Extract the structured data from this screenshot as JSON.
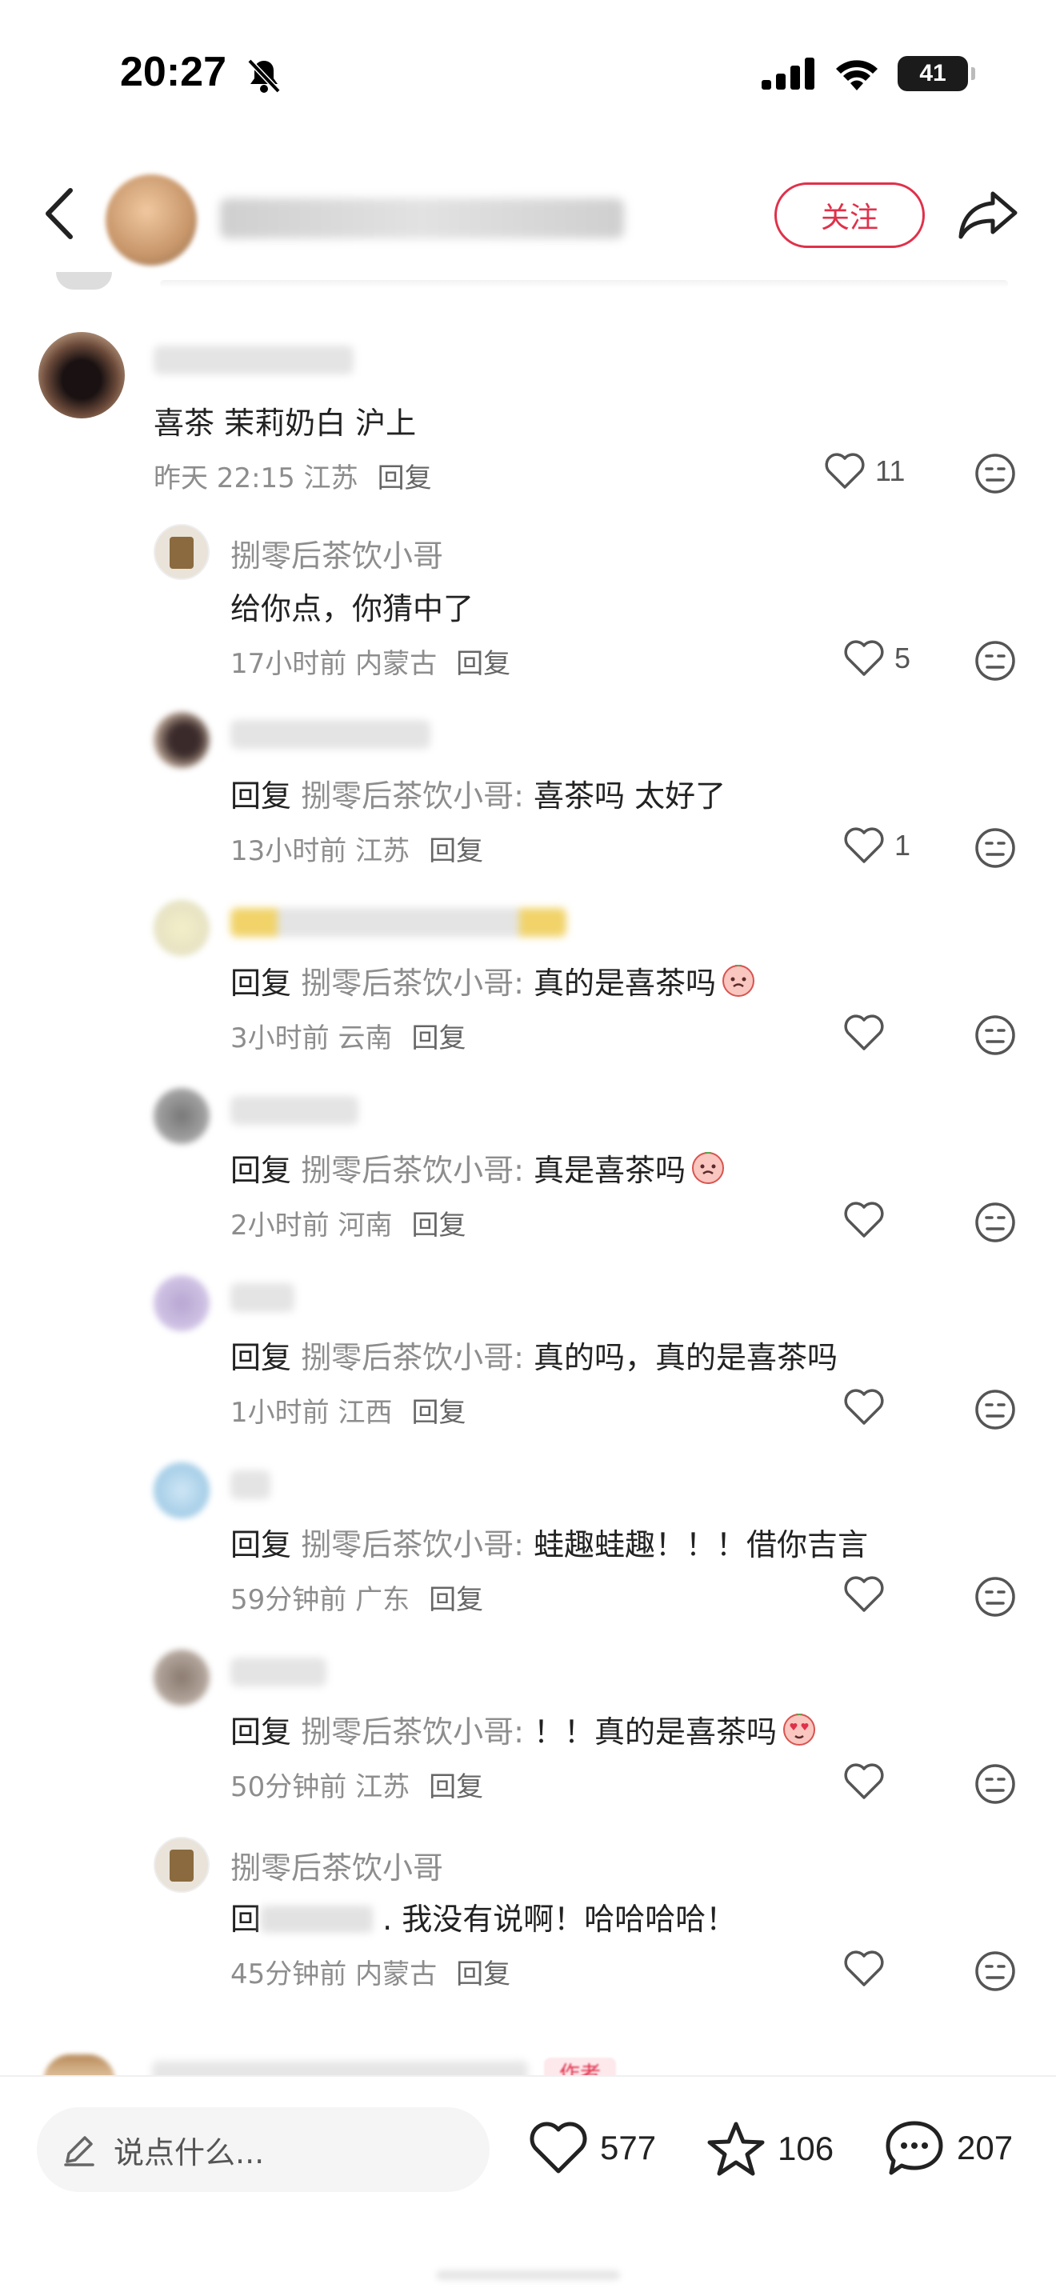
{
  "status_bar": {
    "time": "20:27",
    "battery": "41"
  },
  "header": {
    "follow_label": "关注"
  },
  "comments": [
    {
      "text": "喜茶 茉莉奶白 沪上",
      "time": "昨天 22:15",
      "location": "江苏",
      "reply": "回复",
      "likes": "11"
    },
    {
      "name": "捌零后茶饮小哥",
      "text": "给你点，你猜中了",
      "time": "17小时前",
      "location": "内蒙古",
      "reply": "回复",
      "likes": "5"
    },
    {
      "reply_prefix": "回复",
      "reply_to": "捌零后茶饮小哥:",
      "text": "喜茶吗 太好了",
      "time": "13小时前",
      "location": "江苏",
      "reply": "回复",
      "likes": "1"
    },
    {
      "reply_prefix": "回复",
      "reply_to": "捌零后茶饮小哥:",
      "text": "真的是喜茶吗",
      "time": "3小时前",
      "location": "云南",
      "reply": "回复",
      "likes": ""
    },
    {
      "reply_prefix": "回复",
      "reply_to": "捌零后茶饮小哥:",
      "text": "真是喜茶吗",
      "time": "2小时前",
      "location": "河南",
      "reply": "回复",
      "likes": ""
    },
    {
      "reply_prefix": "回复",
      "reply_to": "捌零后茶饮小哥:",
      "text": "真的吗，真的是喜茶吗",
      "time": "1小时前",
      "location": "江西",
      "reply": "回复",
      "likes": ""
    },
    {
      "reply_prefix": "回复",
      "reply_to": "捌零后茶饮小哥:",
      "text": "蛙趣蛙趣！！！借你吉言",
      "time": "59分钟前",
      "location": "广东",
      "reply": "回复",
      "likes": ""
    },
    {
      "reply_prefix": "回复",
      "reply_to": "捌零后茶饮小哥:",
      "text": "！！真的是喜茶吗",
      "time": "50分钟前",
      "location": "江苏",
      "reply": "回复",
      "likes": ""
    },
    {
      "name": "捌零后茶饮小哥",
      "reply_prefix": "回",
      "text": ". 我没有说啊！哈哈哈哈！",
      "time": "45分钟前",
      "location": "内蒙古",
      "reply": "回复",
      "likes": ""
    }
  ],
  "author_tag": "作者",
  "bottom_bar": {
    "input_placeholder": "说点什么...",
    "likes": "577",
    "favorites": "106",
    "comments": "207"
  },
  "colors": {
    "accent": "#e0314a",
    "muted_text": "#8d8d8d"
  }
}
